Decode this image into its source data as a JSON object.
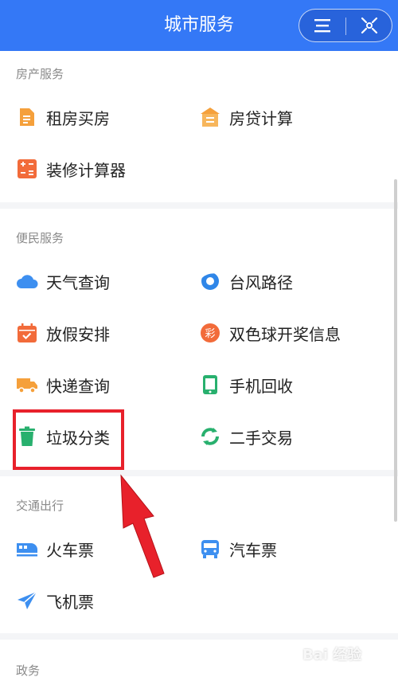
{
  "header": {
    "title": "城市服务"
  },
  "sections": [
    {
      "title": "房产服务",
      "items": [
        {
          "label": "租房买房",
          "icon": "document-icon"
        },
        {
          "label": "房贷计算",
          "icon": "house-icon"
        },
        {
          "label": "装修计算器",
          "icon": "calculator-icon"
        }
      ]
    },
    {
      "title": "便民服务",
      "items": [
        {
          "label": "天气查询",
          "icon": "cloud-icon"
        },
        {
          "label": "台风路径",
          "icon": "typhoon-icon"
        },
        {
          "label": "放假安排",
          "icon": "calendar-icon"
        },
        {
          "label": "双色球开奖信息",
          "icon": "lottery-icon"
        },
        {
          "label": "快递查询",
          "icon": "truck-icon"
        },
        {
          "label": "手机回收",
          "icon": "phone-icon"
        },
        {
          "label": "垃圾分类",
          "icon": "trash-icon"
        },
        {
          "label": "二手交易",
          "icon": "recycle-icon"
        }
      ]
    },
    {
      "title": "交通出行",
      "items": [
        {
          "label": "火车票",
          "icon": "train-icon"
        },
        {
          "label": "汽车票",
          "icon": "bus-icon"
        },
        {
          "label": "飞机票",
          "icon": "plane-icon"
        }
      ]
    },
    {
      "title": "政务",
      "items": []
    }
  ],
  "lottery_glyph": "彩",
  "watermark": "Bai 经验",
  "colors": {
    "header": "#3478f6",
    "highlight": "#e8212b"
  }
}
